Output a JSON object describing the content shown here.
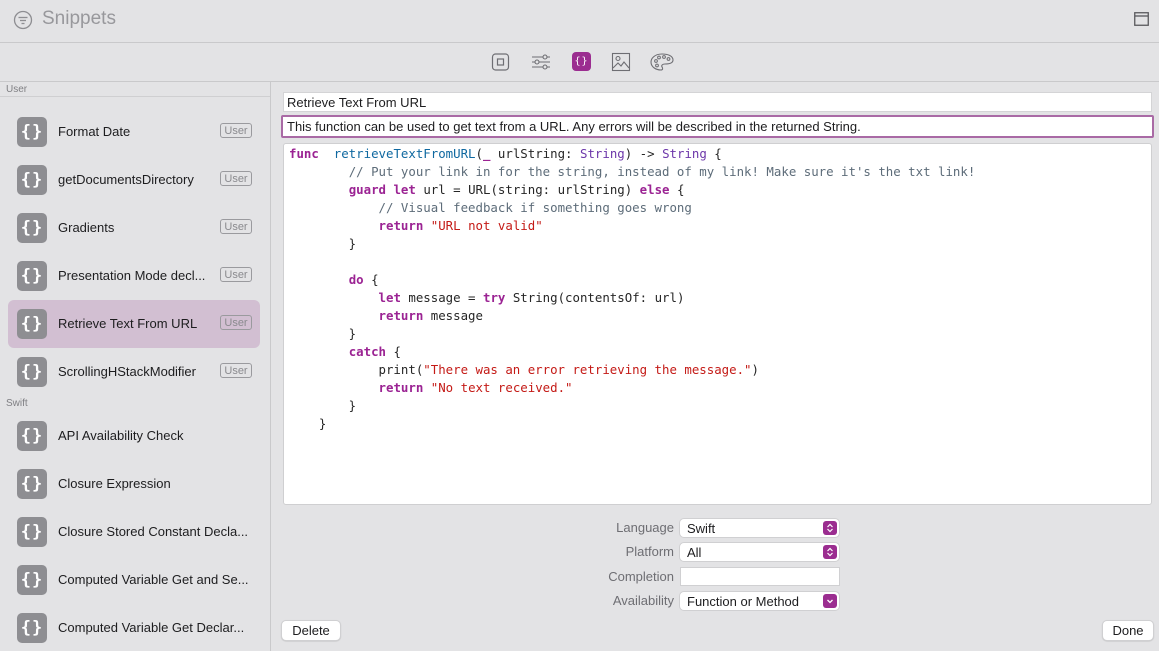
{
  "window": {
    "title": "Snippets",
    "filter_icon": "filter-circle-icon",
    "layout_icon": "sidebar-layout-icon"
  },
  "toolbar": {
    "buttons": [
      {
        "name": "file-template",
        "icon": "square-in-square-icon",
        "active": false
      },
      {
        "name": "snippets-settings",
        "icon": "sliders-icon",
        "active": false
      },
      {
        "name": "code-snippets",
        "icon": "curly-braces-icon",
        "active": true
      },
      {
        "name": "media",
        "icon": "image-icon",
        "active": false
      },
      {
        "name": "colors",
        "icon": "palette-icon",
        "active": false
      }
    ],
    "accent_color": "#9b2d90"
  },
  "sidebar": {
    "sections": [
      {
        "label": "User",
        "items": [
          {
            "label": "Format Date",
            "badge": "User",
            "selected": false
          },
          {
            "label": "getDocumentsDirectory",
            "badge": "User",
            "selected": false
          },
          {
            "label": "Gradients",
            "badge": "User",
            "selected": false
          },
          {
            "label": "Presentation Mode decl...",
            "badge": "User",
            "selected": false
          },
          {
            "label": "Retrieve Text From URL",
            "badge": "User",
            "selected": true
          },
          {
            "label": "ScrollingHStackModifier",
            "badge": "User",
            "selected": false
          }
        ]
      },
      {
        "label": "Swift",
        "items": [
          {
            "label": "API Availability Check",
            "selected": false
          },
          {
            "label": "Closure Expression",
            "selected": false
          },
          {
            "label": "Closure Stored Constant Decla...",
            "selected": false
          },
          {
            "label": "Computed Variable Get and Se...",
            "selected": false
          },
          {
            "label": "Computed Variable Get Declar...",
            "selected": false
          }
        ]
      }
    ],
    "item_icon_glyph": "{}",
    "selected_color": "#d2bfd2"
  },
  "editor": {
    "title": "Retrieve Text From URL",
    "summary": "This function can be used to get text from a URL. Any errors will be described in the returned String.",
    "code_lines": [
      [
        [
          "kw",
          "func"
        ],
        [
          "",
          "  "
        ],
        [
          "fn",
          "retrieveTextFromURL"
        ],
        [
          "",
          "("
        ],
        [
          "kw",
          "_"
        ],
        [
          "",
          ""
        ],
        [
          "",
          " urlString: "
        ],
        [
          "ty",
          "String"
        ],
        [
          "",
          ") -> "
        ],
        [
          "ty",
          "String"
        ],
        [
          "",
          " {"
        ]
      ],
      [
        [
          "",
          "        "
        ],
        [
          "cm",
          "// Put your link in for the string, instead of my link! Make sure it's the txt link!"
        ]
      ],
      [
        [
          "",
          "        "
        ],
        [
          "kw",
          "guard"
        ],
        [
          "",
          " "
        ],
        [
          "kw",
          "let"
        ],
        [
          "",
          " url = URL(string: urlString) "
        ],
        [
          "kw",
          "else"
        ],
        [
          "",
          " {"
        ]
      ],
      [
        [
          "",
          "            "
        ],
        [
          "cm",
          "// Visual feedback if something goes wrong"
        ]
      ],
      [
        [
          "",
          "            "
        ],
        [
          "kw",
          "return"
        ],
        [
          "",
          " "
        ],
        [
          "st",
          "\"URL not valid\""
        ]
      ],
      [
        [
          "",
          "        }"
        ]
      ],
      [
        [
          "",
          ""
        ]
      ],
      [
        [
          "",
          "        "
        ],
        [
          "kw",
          "do"
        ],
        [
          "",
          " {"
        ]
      ],
      [
        [
          "",
          "            "
        ],
        [
          "kw",
          "let"
        ],
        [
          "",
          " message = "
        ],
        [
          "kw",
          "try"
        ],
        [
          "",
          " String(contentsOf: url)"
        ]
      ],
      [
        [
          "",
          "            "
        ],
        [
          "kw",
          "return"
        ],
        [
          "",
          " message"
        ]
      ],
      [
        [
          "",
          "        }"
        ]
      ],
      [
        [
          "",
          "        "
        ],
        [
          "kw",
          "catch"
        ],
        [
          "",
          " {"
        ]
      ],
      [
        [
          "",
          "            print("
        ],
        [
          "st",
          "\"There was an error retrieving the message.\""
        ],
        [
          "",
          ")"
        ]
      ],
      [
        [
          "",
          "            "
        ],
        [
          "kw",
          "return"
        ],
        [
          "",
          " "
        ],
        [
          "st",
          "\"No text received.\""
        ]
      ],
      [
        [
          "",
          "        }"
        ]
      ],
      [
        [
          "",
          "    }"
        ]
      ]
    ]
  },
  "form": {
    "language": {
      "label": "Language",
      "value": "Swift"
    },
    "platform": {
      "label": "Platform",
      "value": "All"
    },
    "completion": {
      "label": "Completion",
      "value": ""
    },
    "availability": {
      "label": "Availability",
      "value": "Function or Method"
    }
  },
  "actions": {
    "delete_label": "Delete",
    "done_label": "Done"
  }
}
